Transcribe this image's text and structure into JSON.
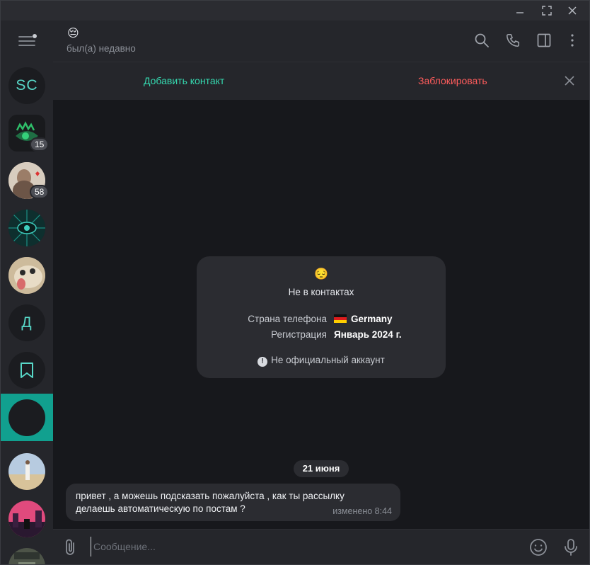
{
  "window": {
    "minimize_icon": "minimize-icon",
    "maximize_icon": "maximize-icon",
    "close_icon": "close-icon"
  },
  "sidebar": {
    "menu_icon": "hamburger-menu-icon",
    "chats": [
      {
        "initials": "SC",
        "badge": ""
      },
      {
        "initials": "",
        "badge": "15",
        "icon": "green-eye-logo"
      },
      {
        "initials": "",
        "badge": "58",
        "icon": "portrait-photo"
      },
      {
        "initials": "",
        "badge": "",
        "icon": "teal-eye-art"
      },
      {
        "initials": "",
        "badge": "",
        "icon": "animal-photo"
      },
      {
        "initials": "Д",
        "badge": ""
      },
      {
        "initials": "",
        "badge": "",
        "icon": "bookmark-icon"
      },
      {
        "initials": "",
        "badge": "",
        "active": true
      },
      {
        "initials": "",
        "badge": "",
        "icon": "desert-photo"
      },
      {
        "initials": "",
        "badge": "",
        "icon": "pink-city-art"
      },
      {
        "initials": "",
        "badge": "",
        "icon": "partial-photo"
      }
    ]
  },
  "header": {
    "emoji": "😔",
    "status": "был(а) недавно",
    "icons": [
      "search-icon",
      "phone-icon",
      "sidebar-toggle-icon",
      "more-vertical-icon"
    ]
  },
  "action_bar": {
    "add_contact": "Добавить контакт",
    "block": "Заблокировать"
  },
  "info_card": {
    "emoji": "😔",
    "title": "Не в контактах",
    "phone_country_label": "Страна телефона",
    "phone_country_value": "Germany",
    "registration_label": "Регистрация",
    "registration_value": "Январь 2024 г.",
    "note": "Не официальный аккаунт"
  },
  "messages": {
    "date": "21 июня",
    "items": [
      {
        "text": "привет , а можешь подсказать пожалуйста , как ты рассылку делаешь автоматическую по постам ?",
        "meta": "изменено 8:44"
      }
    ]
  },
  "composer": {
    "placeholder": "Сообщение..."
  },
  "colors": {
    "accent": "#11a08f",
    "add_contact": "#35d9b0",
    "block": "#ff5c5c",
    "panel": "#25262b",
    "background": "#17181c",
    "bubble": "#2b2c31"
  }
}
